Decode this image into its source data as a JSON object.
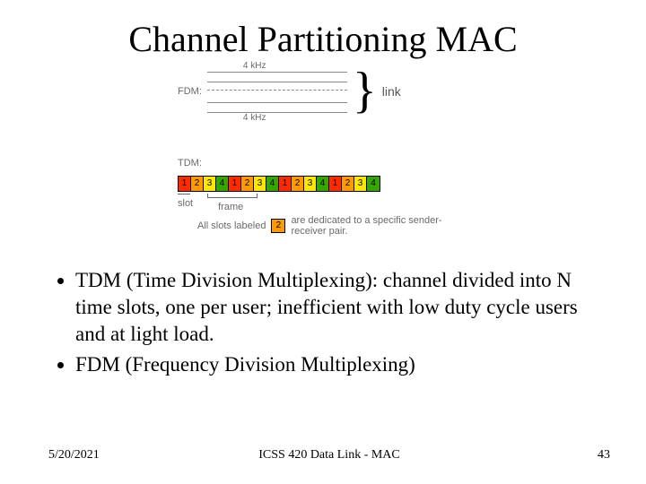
{
  "title": "Channel Partitioning MAC",
  "fdm": {
    "label": "FDM:",
    "band_label": "4 kHz",
    "brace_label": "link"
  },
  "tdm": {
    "label": "TDM:",
    "slot_labels": [
      "1",
      "2",
      "3",
      "4",
      "1",
      "2",
      "3",
      "4",
      "1",
      "2",
      "3",
      "4",
      "1",
      "2",
      "3",
      "4"
    ],
    "slot_caption": "slot",
    "frame_caption": "frame",
    "dedicated_text_a": "All slots labeled",
    "dedicated_text_b": "are dedicated to a specific sender-receiver pair.",
    "dedicated_slot": "2"
  },
  "bullets": [
    "TDM (Time Division Multiplexing): channel divided into N time slots, one per user; inefficient with low duty cycle users and at light load.",
    "FDM (Frequency Division Multiplexing)"
  ],
  "footer": {
    "date": "5/20/2021",
    "center": "ICSS 420 Data Link - MAC",
    "page": "43"
  }
}
